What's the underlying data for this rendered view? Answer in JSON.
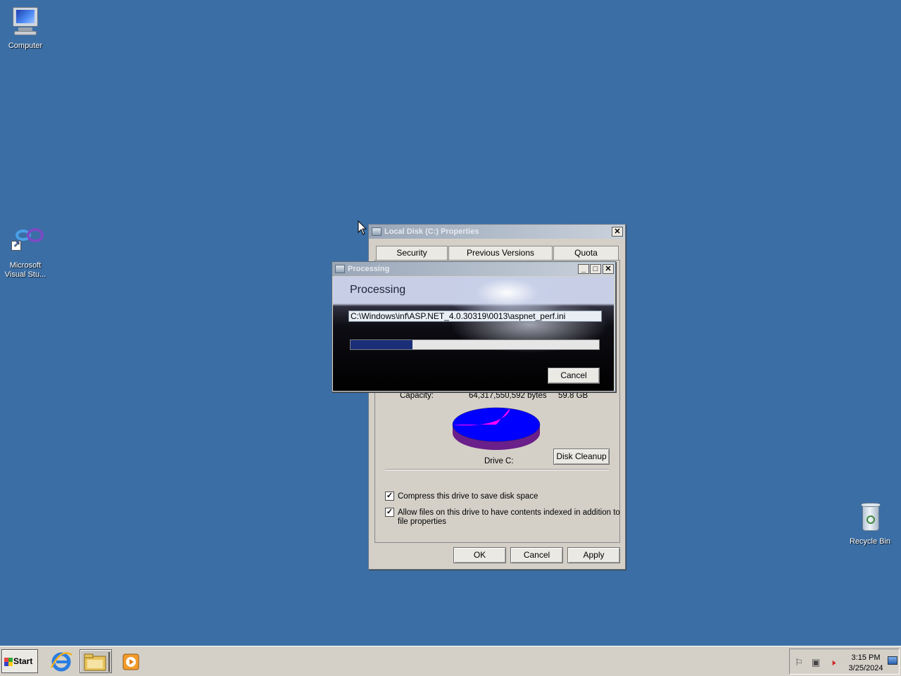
{
  "desktop": {
    "icons": [
      {
        "label": "Computer"
      },
      {
        "label": "Microsoft Visual Stu..."
      },
      {
        "label": "Recycle Bin"
      }
    ]
  },
  "properties_window": {
    "title": "Local Disk (C:) Properties",
    "tabs": [
      "Security",
      "Previous Versions",
      "Quota"
    ],
    "capacity_label": "Capacity:",
    "capacity_bytes": "64,317,550,592 bytes",
    "capacity_gb": "59.8 GB",
    "drive_label": "Drive C:",
    "disk_cleanup_label": "Disk Cleanup",
    "compress_label": "Compress this drive to save disk space",
    "compress_checked": true,
    "index_label_line1": "Allow files on this drive to have contents indexed in addition to",
    "index_label_line2": "file properties",
    "index_checked": true,
    "ok_label": "OK",
    "cancel_label": "Cancel",
    "apply_label": "Apply",
    "pie": {
      "used_fraction": 0.3,
      "used_color": "#ff00ff",
      "free_color": "#0000ff"
    }
  },
  "processing_dialog": {
    "title": "Processing",
    "heading": "Processing",
    "current_path": "C:\\Windows\\inf\\ASP.NET_4.0.30319\\0013\\aspnet_perf.ini",
    "progress_fraction": 0.25,
    "cancel_label": "Cancel"
  },
  "taskbar": {
    "start_label": "Start",
    "clock_time": "3:15 PM",
    "clock_date": "3/25/2024"
  },
  "colors": {
    "desktop": "#3b6ea5",
    "progress_fill": "#1a2f78"
  }
}
